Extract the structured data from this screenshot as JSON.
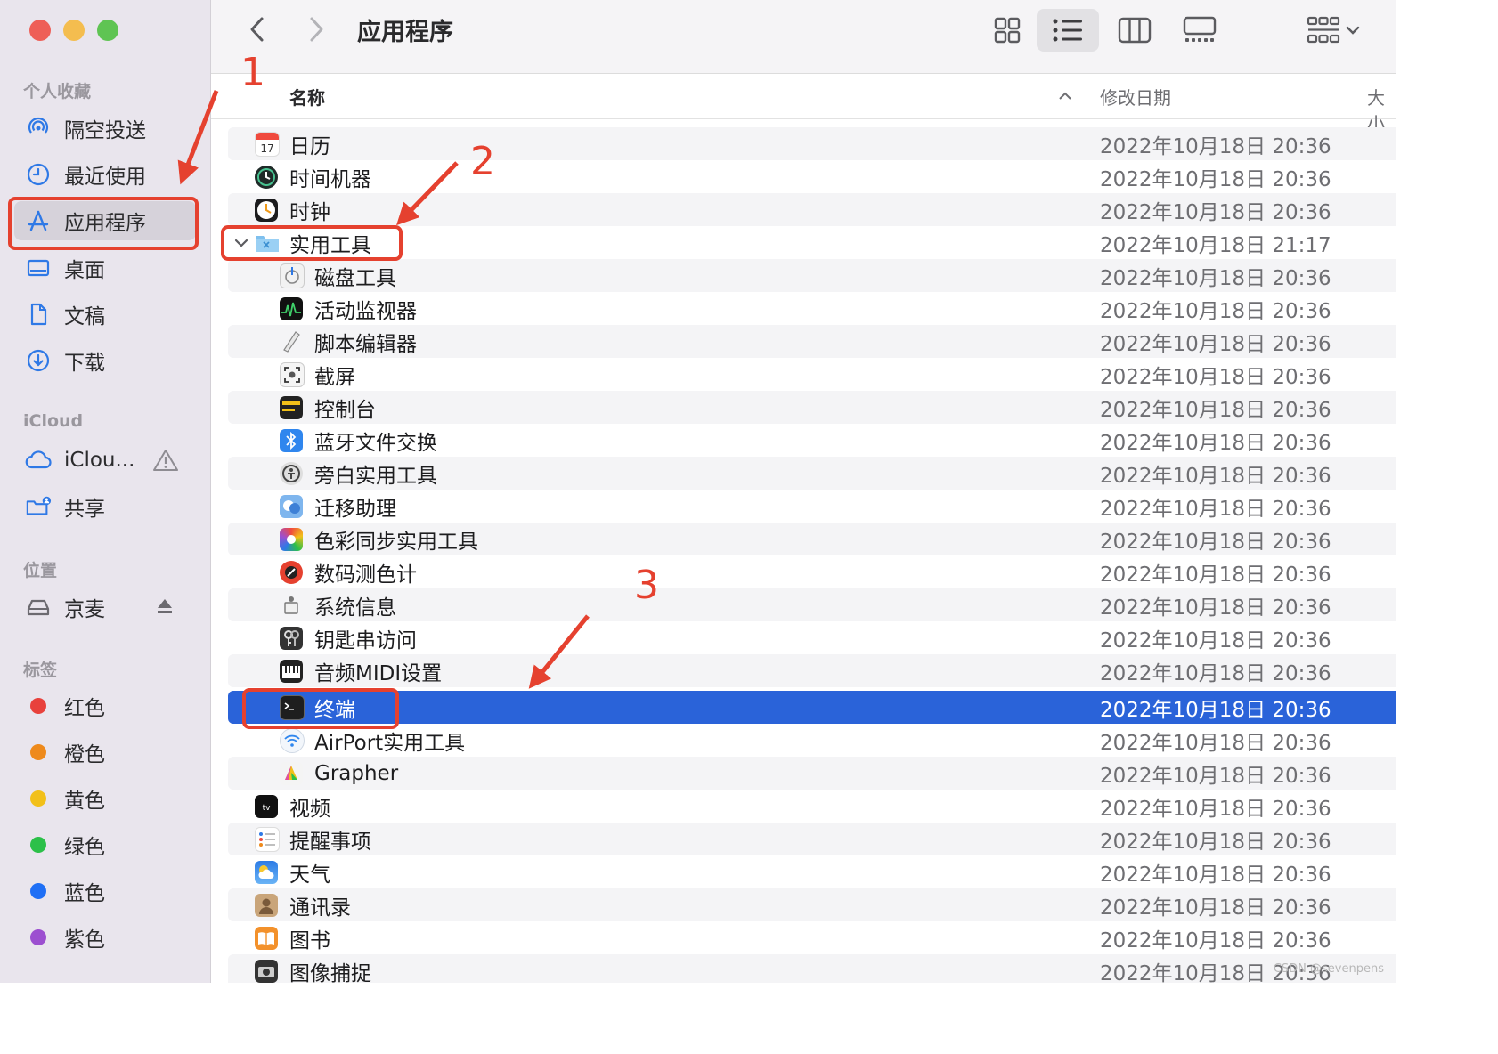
{
  "window": {
    "title": "应用程序"
  },
  "sidebar": {
    "favorites_title": "个人收藏",
    "favorites": [
      {
        "label": "隔空投送",
        "icon": "airdrop-icon"
      },
      {
        "label": "最近使用",
        "icon": "clock-icon"
      },
      {
        "label": "应用程序",
        "icon": "applications-icon",
        "active": true
      },
      {
        "label": "桌面",
        "icon": "desktop-icon"
      },
      {
        "label": "文稿",
        "icon": "document-icon"
      },
      {
        "label": "下载",
        "icon": "download-icon"
      }
    ],
    "icloud_title": "iCloud",
    "icloud": [
      {
        "label": "iClou...",
        "icon": "cloud-icon"
      },
      {
        "label": "共享",
        "icon": "shared-folder-icon"
      }
    ],
    "locations_title": "位置",
    "locations": [
      {
        "label": "京麦",
        "icon": "drive-icon"
      }
    ],
    "tags_title": "标签",
    "tags": [
      {
        "label": "红色",
        "color": "#e8413c"
      },
      {
        "label": "橙色",
        "color": "#ee8a1c"
      },
      {
        "label": "黄色",
        "color": "#f2c019"
      },
      {
        "label": "绿色",
        "color": "#2cc049"
      },
      {
        "label": "蓝色",
        "color": "#1f6ff5"
      },
      {
        "label": "紫色",
        "color": "#9c4fd0"
      }
    ]
  },
  "columns": {
    "name": "名称",
    "modified": "修改日期",
    "size": "大小"
  },
  "rows": [
    {
      "name": "日历",
      "date": "2022年10月18日 20:36",
      "icon": "calendar-icon"
    },
    {
      "name": "时间机器",
      "date": "2022年10月18日 20:36",
      "icon": "time-machine-icon"
    },
    {
      "name": "时钟",
      "date": "2022年10月18日 20:36",
      "icon": "clock-app-icon"
    },
    {
      "name": "实用工具",
      "date": "2022年10月18日 21:17",
      "icon": "utilities-folder-icon",
      "folder": true
    },
    {
      "name": "磁盘工具",
      "date": "2022年10月18日 20:36",
      "icon": "disk-utility-icon",
      "indent": true
    },
    {
      "name": "活动监视器",
      "date": "2022年10月18日 20:36",
      "icon": "activity-monitor-icon",
      "indent": true
    },
    {
      "name": "脚本编辑器",
      "date": "2022年10月18日 20:36",
      "icon": "script-editor-icon",
      "indent": true
    },
    {
      "name": "截屏",
      "date": "2022年10月18日 20:36",
      "icon": "screenshot-icon",
      "indent": true
    },
    {
      "name": "控制台",
      "date": "2022年10月18日 20:36",
      "icon": "console-icon",
      "indent": true
    },
    {
      "name": "蓝牙文件交换",
      "date": "2022年10月18日 20:36",
      "icon": "bluetooth-icon",
      "indent": true
    },
    {
      "name": "旁白实用工具",
      "date": "2022年10月18日 20:36",
      "icon": "voiceover-icon",
      "indent": true
    },
    {
      "name": "迁移助理",
      "date": "2022年10月18日 20:36",
      "icon": "migration-icon",
      "indent": true
    },
    {
      "name": "色彩同步实用工具",
      "date": "2022年10月18日 20:36",
      "icon": "colorsync-icon",
      "indent": true
    },
    {
      "name": "数码测色计",
      "date": "2022年10月18日 20:36",
      "icon": "color-meter-icon",
      "indent": true
    },
    {
      "name": "系统信息",
      "date": "2022年10月18日 20:36",
      "icon": "system-info-icon",
      "indent": true
    },
    {
      "name": "钥匙串访问",
      "date": "2022年10月18日 20:36",
      "icon": "keychain-icon",
      "indent": true
    },
    {
      "name": "音频MIDI设置",
      "date": "2022年10月18日 20:36",
      "icon": "midi-icon",
      "indent": true
    },
    {
      "name": "终端",
      "date": "2022年10月18日 20:36",
      "icon": "terminal-icon",
      "indent": true,
      "selected": true
    },
    {
      "name": "AirPort实用工具",
      "date": "2022年10月18日 20:36",
      "icon": "airport-icon",
      "indent": true
    },
    {
      "name": "Grapher",
      "date": "2022年10月18日 20:36",
      "icon": "grapher-icon",
      "indent": true
    },
    {
      "name": "视频",
      "date": "2022年10月18日 20:36",
      "icon": "tv-icon"
    },
    {
      "name": "提醒事项",
      "date": "2022年10月18日 20:36",
      "icon": "reminders-icon"
    },
    {
      "name": "天气",
      "date": "2022年10月18日 20:36",
      "icon": "weather-icon"
    },
    {
      "name": "通讯录",
      "date": "2022年10月18日 20:36",
      "icon": "contacts-icon"
    },
    {
      "name": "图书",
      "date": "2022年10月18日 20:36",
      "icon": "books-icon"
    },
    {
      "name": "图像捕捉",
      "date": "2022年10月18日 20:36",
      "icon": "image-capture-icon"
    }
  ],
  "annotations": [
    "1",
    "2",
    "3"
  ],
  "watermark": "CSDN @sevenpens"
}
